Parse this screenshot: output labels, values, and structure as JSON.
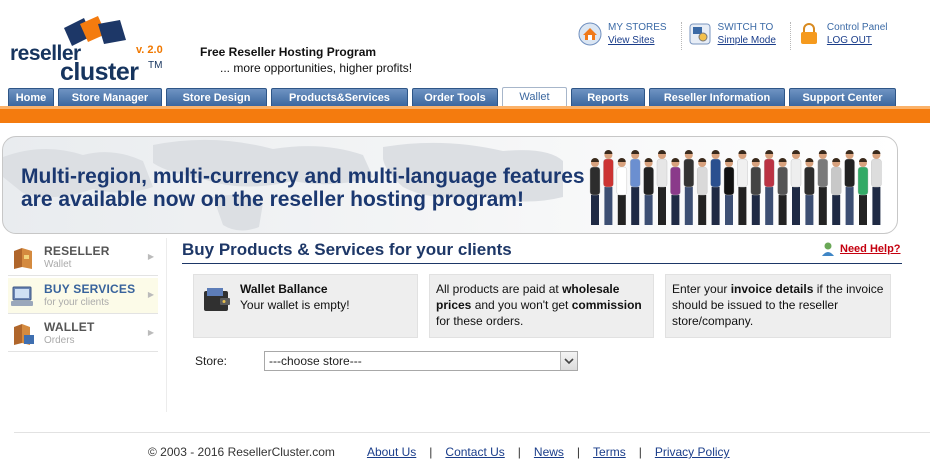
{
  "header": {
    "logo": {
      "word1": "reseller",
      "word2": "cluster",
      "version": "v. 2.0",
      "tm": "TM"
    },
    "tagline_title": "Free Reseller Hosting Program",
    "tagline_sub": "... more opportunities, higher profits!",
    "top_links": [
      {
        "label": "MY STORES",
        "link": "View Sites",
        "icon": "home-icon"
      },
      {
        "label": "SWITCH TO",
        "link": "Simple Mode",
        "icon": "switch-mode-icon"
      },
      {
        "label": "Control Panel",
        "link": "LOG OUT",
        "icon": "lock-icon"
      }
    ]
  },
  "tabs": [
    {
      "label": "Home",
      "active": false
    },
    {
      "label": "Store Manager",
      "active": false
    },
    {
      "label": "Store Design",
      "active": false
    },
    {
      "label": "Products&Services",
      "active": false
    },
    {
      "label": "Order Tools",
      "active": false
    },
    {
      "label": "Wallet",
      "active": true
    },
    {
      "label": "Reports",
      "active": false
    },
    {
      "label": "Reseller Information",
      "active": false
    },
    {
      "label": "Support Center",
      "active": false
    }
  ],
  "banner": {
    "line1": "Multi-region, multi-currency and multi-language features",
    "line2": "are available now on the reseller hosting program!"
  },
  "sidebar": {
    "items": [
      {
        "title": "RESELLER",
        "subtitle": "Wallet",
        "icon": "wallet-book-icon",
        "active": false
      },
      {
        "title": "BUY SERVICES",
        "subtitle": "for your clients",
        "icon": "computer-icon",
        "active": true
      },
      {
        "title": "WALLET",
        "subtitle": "Orders",
        "icon": "orders-icon",
        "active": false
      }
    ]
  },
  "main": {
    "title": "Buy Products & Services for your clients",
    "help_link": "Need Help?",
    "wallet_box": {
      "title": "Wallet Ballance",
      "text": "Your wallet is empty!"
    },
    "paid_box": {
      "p1": "All products are paid at ",
      "b1": "wholesale prices",
      "p2": " and you won't get ",
      "b2": "commission",
      "p3": " for these orders."
    },
    "invoice_box": {
      "p1": "Enter your ",
      "b1": "invoice details",
      "p2": " if the invoice should be issued to the reseller store/company."
    },
    "store_label": "Store:",
    "store_select_value": "---choose store---"
  },
  "footer": {
    "copyright": "© 2003 - 2016 ResellerCluster.com",
    "links": [
      "About Us",
      "Contact Us",
      "News",
      "Terms",
      "Privacy Policy"
    ],
    "separator": "|"
  },
  "colors": {
    "brand_blue": "#1d3767",
    "tab_blue": "#4a76ae",
    "orange": "#f47b0e",
    "help_red": "#c5000f"
  }
}
